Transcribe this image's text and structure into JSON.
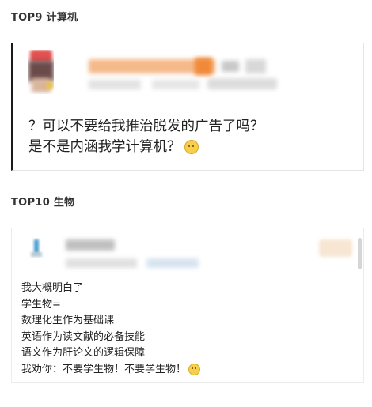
{
  "sections": [
    {
      "heading": "TOP9 计算机",
      "content_lines": [
        "？可以不要给我推治脱发的广告了吗？",
        "是不是内涵我学计算机？"
      ],
      "emoji_icon": "slightly-smiling-face-icon"
    },
    {
      "heading": "TOP10 生物",
      "content_lines": [
        "我大概明白了",
        "学生物=",
        "数理化生作为基础课",
        "英语作为读文献的必备技能",
        "语文作为肝论文的逻辑保障",
        "我劝你：不要学生物！不要学生物！"
      ],
      "emoji_icon": "slightly-smiling-face-icon"
    }
  ],
  "colors": {
    "accent_border": "#1a1a1a",
    "blurred_name": "#f2a46a",
    "emoji": "#f6cf4b"
  }
}
